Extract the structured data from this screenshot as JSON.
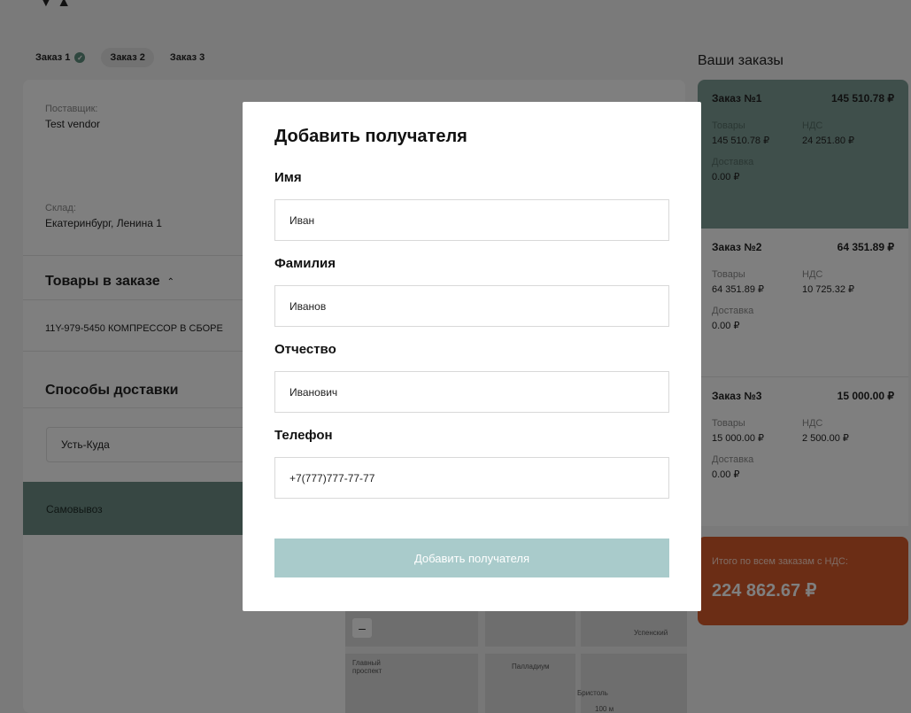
{
  "tabs": [
    {
      "label": "Заказ 1"
    },
    {
      "label": "Заказ 2"
    },
    {
      "label": "Заказ 3"
    }
  ],
  "order": {
    "supplier_label": "Поставщик:",
    "supplier_value": "Test vendor",
    "warehouse_label": "Склад:",
    "warehouse_value": "Екатеринбург, Ленина 1",
    "items_title": "Товары в заказе",
    "item_name": "11Y-979-5450 КОМПРЕССОР В СБОРЕ",
    "delivery_title": "Способы доставки",
    "city": "Усть-Куда",
    "pickup": "Самовывоз"
  },
  "map": {
    "labels": [
      "Главный проспект",
      "Палладиум",
      "Бристоль",
      "Успенский"
    ],
    "scale": "100 м"
  },
  "orders_panel": {
    "title": "Ваши заказы",
    "items_label": "Товары",
    "vat_label": "НДС",
    "delivery_label": "Доставка",
    "orders": [
      {
        "name": "Заказ №1",
        "total": "145 510.78 ₽",
        "items": "145 510.78 ₽",
        "vat": "24 251.80 ₽",
        "delivery": "0.00 ₽"
      },
      {
        "name": "Заказ №2",
        "total": "64 351.89 ₽",
        "items": "64 351.89 ₽",
        "vat": "10 725.32 ₽",
        "delivery": "0.00 ₽"
      },
      {
        "name": "Заказ №3",
        "total": "15 000.00 ₽",
        "items": "15 000.00 ₽",
        "vat": "2 500.00 ₽",
        "delivery": "0.00 ₽"
      }
    ],
    "grand_total_label": "Итого по всем заказам с НДС:",
    "grand_total": "224 862.67 ₽"
  },
  "modal": {
    "title": "Добавить получателя",
    "first_name_label": "Имя",
    "first_name_value": "Иван",
    "last_name_label": "Фамилия",
    "last_name_value": "Иванов",
    "patronymic_label": "Отчество",
    "patronymic_value": "Иванович",
    "phone_label": "Телефон",
    "phone_value": "+7(777)777-77-77",
    "submit_label": "Добавить получателя"
  },
  "colors": {
    "accent_green": "#7f9e96",
    "total_orange": "#d65a2a",
    "submit_disabled": "#a9cbcb"
  }
}
